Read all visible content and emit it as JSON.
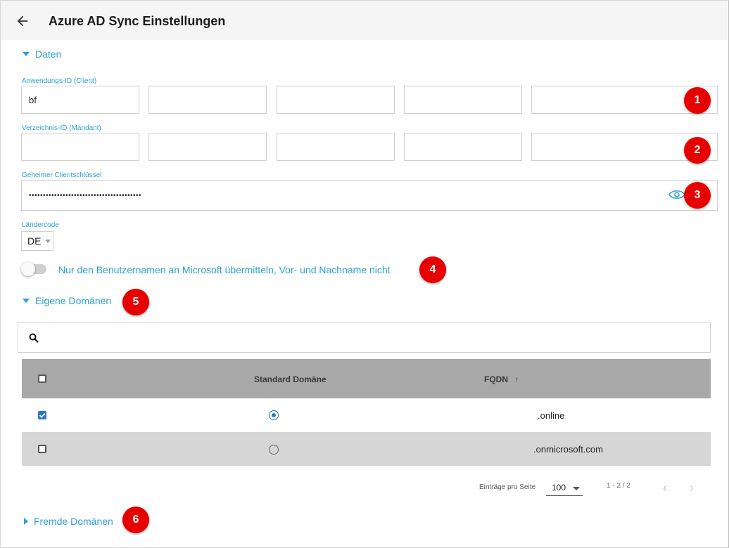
{
  "header": {
    "title": "Azure AD Sync Einstellungen"
  },
  "sections": {
    "daten": "Daten",
    "eigene_domaenen": "Eigene Domänen",
    "fremde_domaenen": "Fremde Domänen"
  },
  "fields": {
    "client_id": {
      "label": "Anwendungs-ID (Client)",
      "segments": [
        "bf",
        "",
        "",
        "",
        ""
      ]
    },
    "tenant_id": {
      "label": "Verzeichnis-ID (Mandant)",
      "segments": [
        "",
        "",
        "",
        "",
        ""
      ]
    },
    "secret": {
      "label": "Geheimer Clientschlüssel",
      "value": "••••••••••••••••••••••••••••••••••••••••"
    },
    "country": {
      "label": "Ländercode",
      "value": "DE"
    }
  },
  "toggle": {
    "label": "Nur den Benutzernamen an Microsoft übermitteln, Vor- und Nachname nicht",
    "on": false
  },
  "badges": [
    "1",
    "2",
    "3",
    "4",
    "5",
    "6"
  ],
  "table": {
    "columns": {
      "standard": "Standard Domäne",
      "fqdn": "FQDN",
      "sort_glyph": "↑"
    },
    "rows": [
      {
        "checked": true,
        "standard": true,
        "fqdn": ".online"
      },
      {
        "checked": false,
        "standard": false,
        "fqdn": ".onmicrosoft.com"
      }
    ]
  },
  "pagination": {
    "label": "Einträge pro Seite",
    "per_page": "100",
    "range": "1 - 2 / 2",
    "prev": "‹",
    "next": "›"
  },
  "colors": {
    "accent": "#2aa1d4",
    "badge": "#e60000",
    "header_bg": "#f5f5f5",
    "table_head": "#a8a8a8",
    "row_alt": "#d6d6d6"
  },
  "icons": [
    "back-arrow-icon",
    "search-icon",
    "eye-icon",
    "caret-down-icon",
    "caret-right-icon",
    "sort-up-icon"
  ]
}
